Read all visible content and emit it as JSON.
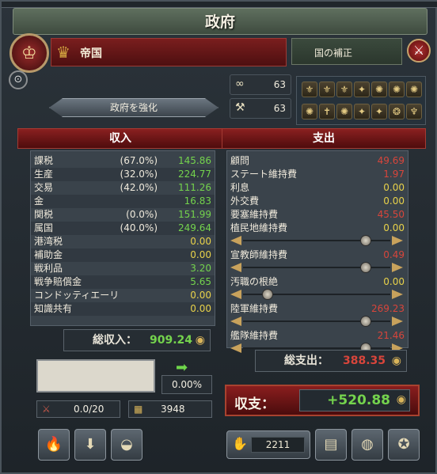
{
  "title": "政府",
  "country": {
    "name": "帝国"
  },
  "national_bonus": {
    "label": "国の補正"
  },
  "stats": [
    {
      "icon": "influence-icon",
      "value": "63"
    },
    {
      "icon": "bureaucracy-icon",
      "value": "63"
    }
  ],
  "strengthen_button": "政府を強化",
  "income": {
    "header": "収入",
    "rows": [
      {
        "name": "課税",
        "pct": "(67.0%)",
        "value": "145.86"
      },
      {
        "name": "生産",
        "pct": "(32.0%)",
        "value": "224.77"
      },
      {
        "name": "交易",
        "pct": "(42.0%)",
        "value": "111.26"
      },
      {
        "name": "金",
        "pct": "",
        "value": "16.83"
      },
      {
        "name": "関税",
        "pct": "(0.0%)",
        "value": "151.99"
      },
      {
        "name": "属国",
        "pct": "(40.0%)",
        "value": "249.64"
      },
      {
        "name": "港湾税",
        "pct": "",
        "value": "0.00"
      },
      {
        "name": "補助金",
        "pct": "",
        "value": "0.00"
      },
      {
        "name": "戦利品",
        "pct": "",
        "value": "3.20"
      },
      {
        "name": "戦争賠償金",
        "pct": "",
        "value": "5.65"
      },
      {
        "name": "コンドッティエーリ",
        "pct": "",
        "value": "0.00"
      },
      {
        "name": "知識共有",
        "pct": "",
        "value": "0.00"
      }
    ],
    "total_label": "総収入：",
    "total_value": "909.24"
  },
  "expense": {
    "header": "支出",
    "rows": [
      {
        "name": "顧問",
        "value": "49.69"
      },
      {
        "name": "ステート維持費",
        "value": "1.97"
      },
      {
        "name": "利息",
        "value": "0.00"
      },
      {
        "name": "外交費",
        "value": "0.00"
      },
      {
        "name": "要塞維持費",
        "value": "45.50"
      },
      {
        "name": "植民地維持費",
        "value": "0.00"
      },
      {
        "name": "宣教師維持費",
        "value": "0.49"
      },
      {
        "name": "汚職の根絶",
        "value": "0.00"
      },
      {
        "name": "陸軍維持費",
        "value": "269.23"
      },
      {
        "name": "艦隊維持費",
        "value": "21.46"
      }
    ],
    "total_label": "総支出：",
    "total_value": "388.35"
  },
  "slider_levels": {
    "colonial": 0.86,
    "missionary": 0.86,
    "corruption": 0.14,
    "army": 0.86,
    "navy": 0.86
  },
  "loan_percent": "0.00%",
  "war_exhaustion": "0.0/20",
  "treasury": "3948",
  "balance": {
    "label": "収支：",
    "value": "+520.88"
  },
  "gold_amount": "2211",
  "colors": {
    "income_green": "#74d34d",
    "expense_red": "#d8453b",
    "zero_yellow": "#e8d24a"
  }
}
